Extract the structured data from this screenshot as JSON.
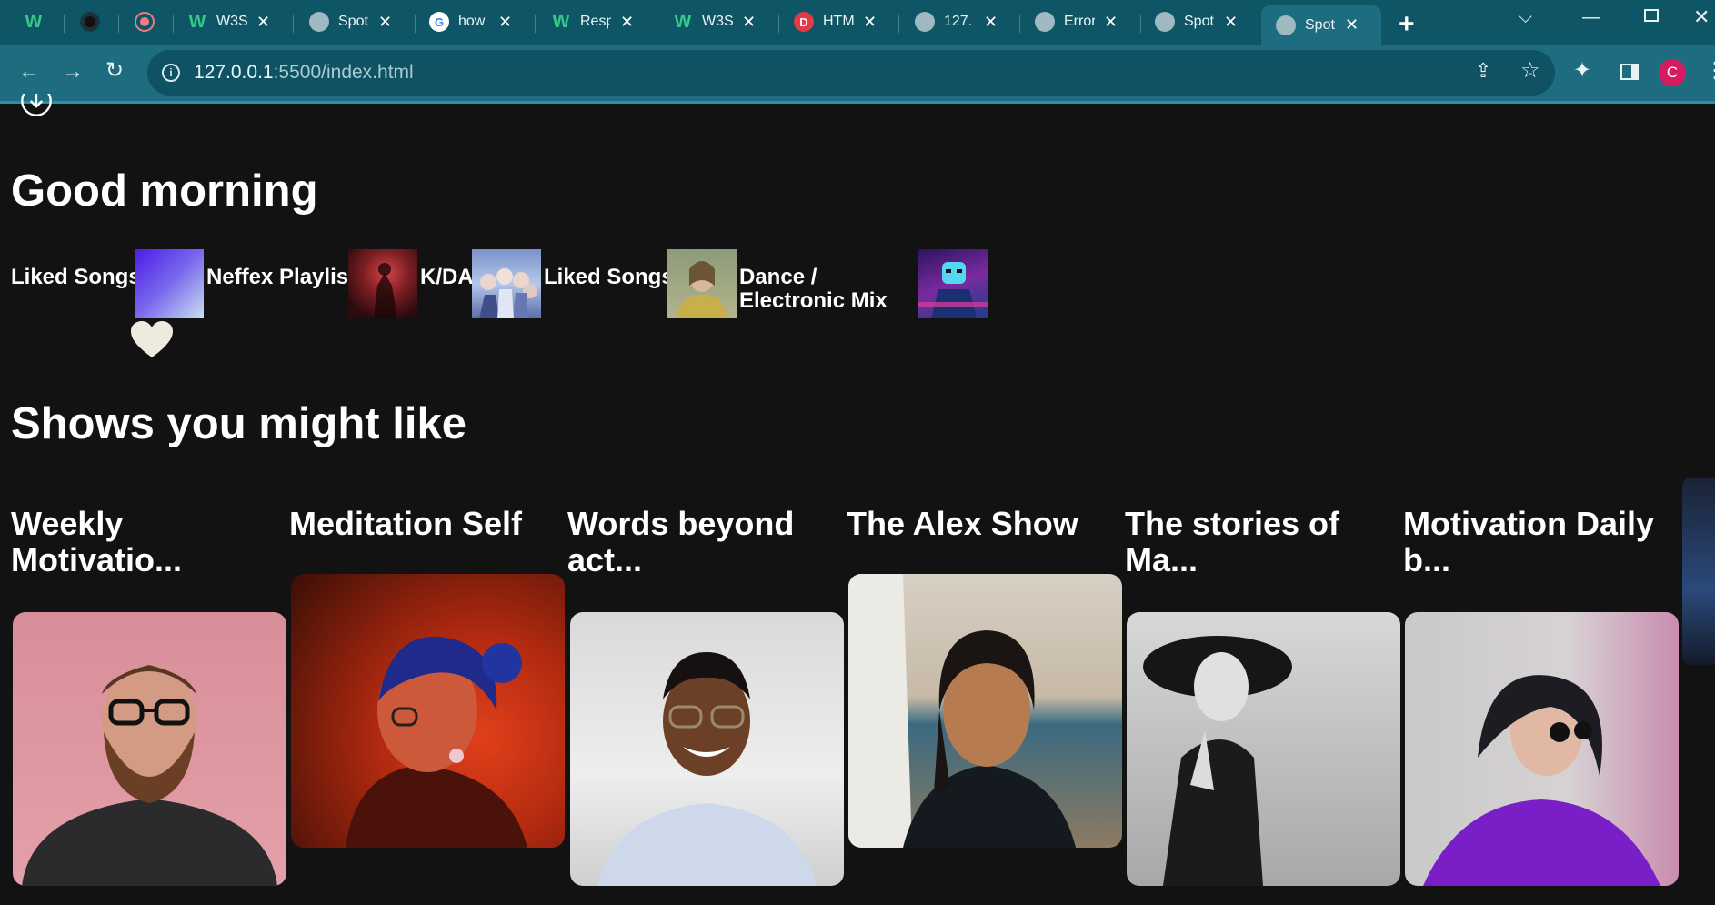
{
  "browser": {
    "tabs": [
      {
        "title": "",
        "favicon": "w3schools-icon"
      },
      {
        "title": "",
        "favicon": "github-icon"
      },
      {
        "title": "",
        "favicon": "record-icon"
      },
      {
        "title": "W3S",
        "favicon": "w3schools-icon"
      },
      {
        "title": "Spot",
        "favicon": "globe-icon"
      },
      {
        "title": "how",
        "favicon": "google-icon"
      },
      {
        "title": "Resp",
        "favicon": "w3schools-icon"
      },
      {
        "title": "W3S",
        "favicon": "w3schools-icon"
      },
      {
        "title": "HTM",
        "favicon": "d-icon"
      },
      {
        "title": "127.",
        "favicon": "globe-icon"
      },
      {
        "title": "Error",
        "favicon": "globe-icon"
      },
      {
        "title": "Spot",
        "favicon": "globe-icon"
      },
      {
        "title": "Spot",
        "favicon": "globe-icon"
      }
    ],
    "url_host": "127.0.0.1",
    "url_path": ":5500/index.html",
    "profile_initial": "C",
    "accent_color": "#1d6c80"
  },
  "page": {
    "greeting": "Good morning",
    "quick": [
      {
        "label": "Liked Songs"
      },
      {
        "label": "Neffex Playlist"
      },
      {
        "label": "K/DA"
      },
      {
        "label": "Liked Songs"
      },
      {
        "label": "Dance / Electronic Mix"
      }
    ],
    "shows_heading": "Shows you might like",
    "shows": [
      {
        "title": "Weekly Motivatio..."
      },
      {
        "title": "Meditation Self"
      },
      {
        "title": "Words beyond act..."
      },
      {
        "title": "The Alex Show"
      },
      {
        "title": "The stories of Ma..."
      },
      {
        "title": "Motivation Daily b..."
      }
    ]
  }
}
